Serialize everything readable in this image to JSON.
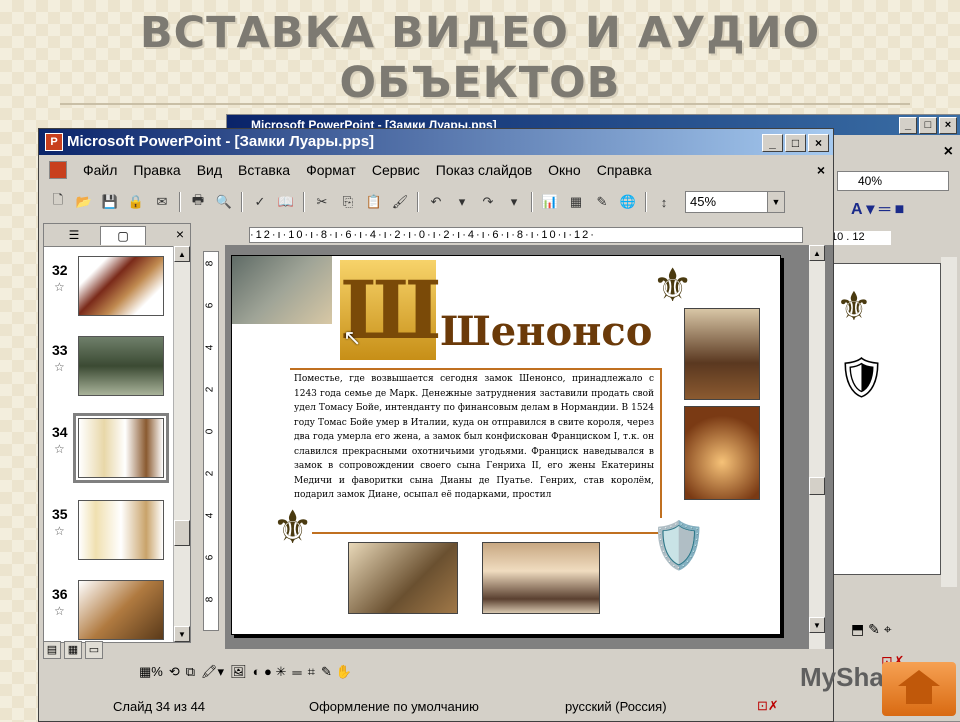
{
  "slide_title": "ВСТАВКА ВИДЕО И АУДИО ОБЪЕКТОВ",
  "back_window": {
    "title": "Microsoft PowerPoint - [Замки Луары.pps]",
    "zoom": "40%",
    "ruler": "10 . 12"
  },
  "front_window": {
    "title": "Microsoft PowerPoint - [Замки Луары.pps]",
    "menu": [
      "Файл",
      "Правка",
      "Вид",
      "Вставка",
      "Формат",
      "Сервис",
      "Показ слайдов",
      "Окно",
      "Справка"
    ],
    "zoom": "45%",
    "ruler_h": "·12·ı·10·ı·8·ı·6·ı·4·ı·2·ı·0·ı·2·ı·4·ı·6·ı·8·ı·10·ı·12·",
    "ruler_v": [
      "8",
      "6",
      "4",
      "2",
      "0",
      "2",
      "4",
      "6",
      "8"
    ],
    "thumbnails": [
      {
        "num": "32",
        "selected": false
      },
      {
        "num": "33",
        "selected": false
      },
      {
        "num": "34",
        "selected": true
      },
      {
        "num": "35",
        "selected": false
      },
      {
        "num": "36",
        "selected": false
      }
    ],
    "slide": {
      "heading": "Шенонсо",
      "body": "Поместье, где возвышается сегодня замок Шенонсо, принадлежало с 1243 года семье де Марк. Денежные затруднения заставили продать свой удел Томасу Бойе, интенданту по финансовым делам в Нормандии. В 1524 году Томас Бойе умер в Италии, куда он отправился в свите короля, через два года умерла его жена, а замок был конфискован Франциском I, т.к. он славился прекрасными охотничьими угодьями. Франциск наведывался в замок в сопровождении своего сына Генриха II, его жены Екатерины Медичи и фаворитки сына Дианы де Пуатье. Генрих, став королём, подарил замок Диане, осыпал её подарками, простил"
    },
    "status": {
      "slide": "Слайд 34 из 44",
      "design": "Оформление по умолчанию",
      "language": "русский (Россия)"
    }
  },
  "watermark": "MyShared"
}
